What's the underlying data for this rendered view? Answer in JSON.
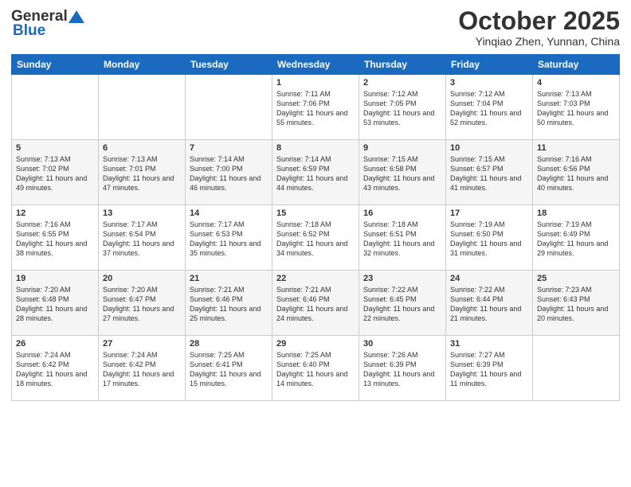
{
  "header": {
    "logo_general": "General",
    "logo_blue": "Blue",
    "month_title": "October 2025",
    "location": "Yinqiao Zhen, Yunnan, China"
  },
  "weekdays": [
    "Sunday",
    "Monday",
    "Tuesday",
    "Wednesday",
    "Thursday",
    "Friday",
    "Saturday"
  ],
  "weeks": [
    [
      {
        "day": "",
        "sunrise": "",
        "sunset": "",
        "daylight": ""
      },
      {
        "day": "",
        "sunrise": "",
        "sunset": "",
        "daylight": ""
      },
      {
        "day": "",
        "sunrise": "",
        "sunset": "",
        "daylight": ""
      },
      {
        "day": "1",
        "sunrise": "Sunrise: 7:11 AM",
        "sunset": "Sunset: 7:06 PM",
        "daylight": "Daylight: 11 hours and 55 minutes."
      },
      {
        "day": "2",
        "sunrise": "Sunrise: 7:12 AM",
        "sunset": "Sunset: 7:05 PM",
        "daylight": "Daylight: 11 hours and 53 minutes."
      },
      {
        "day": "3",
        "sunrise": "Sunrise: 7:12 AM",
        "sunset": "Sunset: 7:04 PM",
        "daylight": "Daylight: 11 hours and 52 minutes."
      },
      {
        "day": "4",
        "sunrise": "Sunrise: 7:13 AM",
        "sunset": "Sunset: 7:03 PM",
        "daylight": "Daylight: 11 hours and 50 minutes."
      }
    ],
    [
      {
        "day": "5",
        "sunrise": "Sunrise: 7:13 AM",
        "sunset": "Sunset: 7:02 PM",
        "daylight": "Daylight: 11 hours and 49 minutes."
      },
      {
        "day": "6",
        "sunrise": "Sunrise: 7:13 AM",
        "sunset": "Sunset: 7:01 PM",
        "daylight": "Daylight: 11 hours and 47 minutes."
      },
      {
        "day": "7",
        "sunrise": "Sunrise: 7:14 AM",
        "sunset": "Sunset: 7:00 PM",
        "daylight": "Daylight: 11 hours and 46 minutes."
      },
      {
        "day": "8",
        "sunrise": "Sunrise: 7:14 AM",
        "sunset": "Sunset: 6:59 PM",
        "daylight": "Daylight: 11 hours and 44 minutes."
      },
      {
        "day": "9",
        "sunrise": "Sunrise: 7:15 AM",
        "sunset": "Sunset: 6:58 PM",
        "daylight": "Daylight: 11 hours and 43 minutes."
      },
      {
        "day": "10",
        "sunrise": "Sunrise: 7:15 AM",
        "sunset": "Sunset: 6:57 PM",
        "daylight": "Daylight: 11 hours and 41 minutes."
      },
      {
        "day": "11",
        "sunrise": "Sunrise: 7:16 AM",
        "sunset": "Sunset: 6:56 PM",
        "daylight": "Daylight: 11 hours and 40 minutes."
      }
    ],
    [
      {
        "day": "12",
        "sunrise": "Sunrise: 7:16 AM",
        "sunset": "Sunset: 6:55 PM",
        "daylight": "Daylight: 11 hours and 38 minutes."
      },
      {
        "day": "13",
        "sunrise": "Sunrise: 7:17 AM",
        "sunset": "Sunset: 6:54 PM",
        "daylight": "Daylight: 11 hours and 37 minutes."
      },
      {
        "day": "14",
        "sunrise": "Sunrise: 7:17 AM",
        "sunset": "Sunset: 6:53 PM",
        "daylight": "Daylight: 11 hours and 35 minutes."
      },
      {
        "day": "15",
        "sunrise": "Sunrise: 7:18 AM",
        "sunset": "Sunset: 6:52 PM",
        "daylight": "Daylight: 11 hours and 34 minutes."
      },
      {
        "day": "16",
        "sunrise": "Sunrise: 7:18 AM",
        "sunset": "Sunset: 6:51 PM",
        "daylight": "Daylight: 11 hours and 32 minutes."
      },
      {
        "day": "17",
        "sunrise": "Sunrise: 7:19 AM",
        "sunset": "Sunset: 6:50 PM",
        "daylight": "Daylight: 11 hours and 31 minutes."
      },
      {
        "day": "18",
        "sunrise": "Sunrise: 7:19 AM",
        "sunset": "Sunset: 6:49 PM",
        "daylight": "Daylight: 11 hours and 29 minutes."
      }
    ],
    [
      {
        "day": "19",
        "sunrise": "Sunrise: 7:20 AM",
        "sunset": "Sunset: 6:48 PM",
        "daylight": "Daylight: 11 hours and 28 minutes."
      },
      {
        "day": "20",
        "sunrise": "Sunrise: 7:20 AM",
        "sunset": "Sunset: 6:47 PM",
        "daylight": "Daylight: 11 hours and 27 minutes."
      },
      {
        "day": "21",
        "sunrise": "Sunrise: 7:21 AM",
        "sunset": "Sunset: 6:46 PM",
        "daylight": "Daylight: 11 hours and 25 minutes."
      },
      {
        "day": "22",
        "sunrise": "Sunrise: 7:21 AM",
        "sunset": "Sunset: 6:46 PM",
        "daylight": "Daylight: 11 hours and 24 minutes."
      },
      {
        "day": "23",
        "sunrise": "Sunrise: 7:22 AM",
        "sunset": "Sunset: 6:45 PM",
        "daylight": "Daylight: 11 hours and 22 minutes."
      },
      {
        "day": "24",
        "sunrise": "Sunrise: 7:22 AM",
        "sunset": "Sunset: 6:44 PM",
        "daylight": "Daylight: 11 hours and 21 minutes."
      },
      {
        "day": "25",
        "sunrise": "Sunrise: 7:23 AM",
        "sunset": "Sunset: 6:43 PM",
        "daylight": "Daylight: 11 hours and 20 minutes."
      }
    ],
    [
      {
        "day": "26",
        "sunrise": "Sunrise: 7:24 AM",
        "sunset": "Sunset: 6:42 PM",
        "daylight": "Daylight: 11 hours and 18 minutes."
      },
      {
        "day": "27",
        "sunrise": "Sunrise: 7:24 AM",
        "sunset": "Sunset: 6:42 PM",
        "daylight": "Daylight: 11 hours and 17 minutes."
      },
      {
        "day": "28",
        "sunrise": "Sunrise: 7:25 AM",
        "sunset": "Sunset: 6:41 PM",
        "daylight": "Daylight: 11 hours and 15 minutes."
      },
      {
        "day": "29",
        "sunrise": "Sunrise: 7:25 AM",
        "sunset": "Sunset: 6:40 PM",
        "daylight": "Daylight: 11 hours and 14 minutes."
      },
      {
        "day": "30",
        "sunrise": "Sunrise: 7:26 AM",
        "sunset": "Sunset: 6:39 PM",
        "daylight": "Daylight: 11 hours and 13 minutes."
      },
      {
        "day": "31",
        "sunrise": "Sunrise: 7:27 AM",
        "sunset": "Sunset: 6:39 PM",
        "daylight": "Daylight: 11 hours and 11 minutes."
      },
      {
        "day": "",
        "sunrise": "",
        "sunset": "",
        "daylight": ""
      }
    ]
  ]
}
